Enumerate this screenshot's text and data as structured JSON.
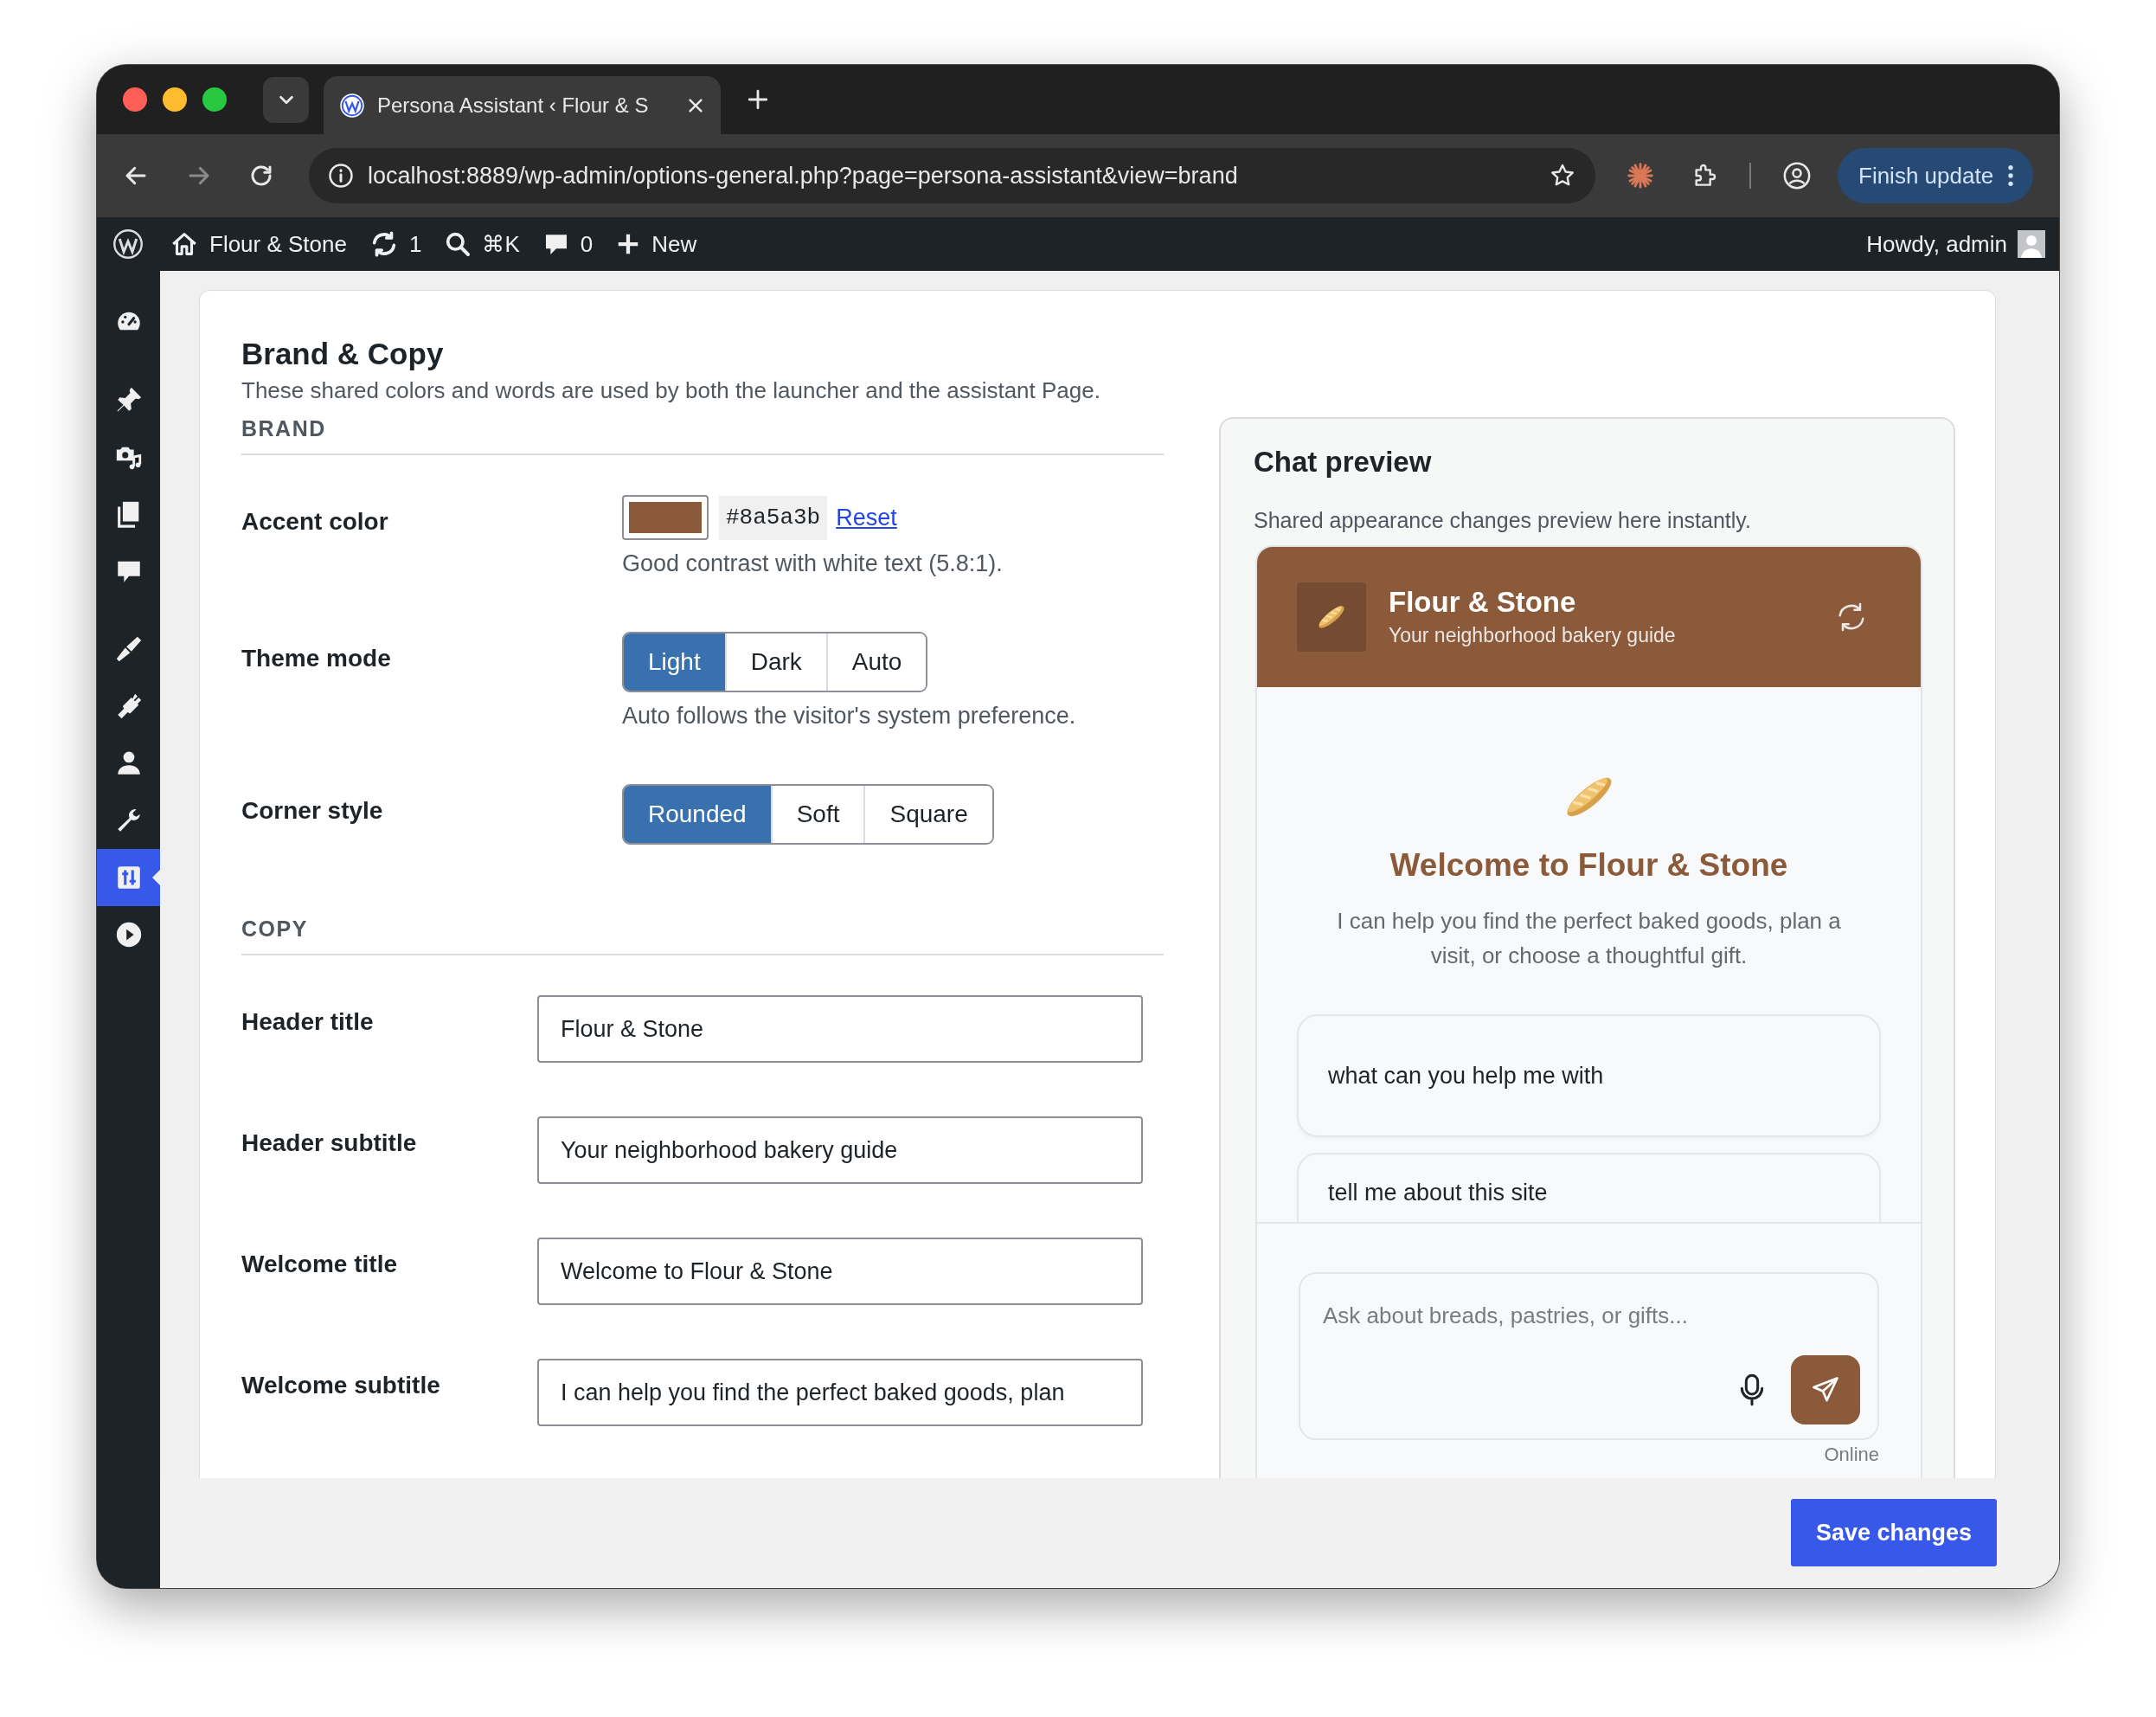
{
  "browser": {
    "tab_title": "Persona Assistant ‹ Flour & S",
    "url": "localhost:8889/wp-admin/options-general.php?page=persona-assistant&view=brand",
    "update_button": "Finish update"
  },
  "admin_bar": {
    "site_name": "Flour & Stone",
    "updates": "1",
    "search_shortcut": "⌘K",
    "comments": "0",
    "new_label": "New",
    "greeting": "Howdy, admin"
  },
  "sidebar": {
    "items": [
      {
        "selected": false
      },
      {
        "selected": false
      },
      {
        "selected": false
      },
      {
        "selected": false
      },
      {
        "selected": false
      },
      {
        "selected": false
      },
      {
        "selected": false
      },
      {
        "selected": false
      },
      {
        "selected": false
      },
      {
        "selected": true
      },
      {
        "selected": false
      }
    ]
  },
  "settings": {
    "title": "Brand & Copy",
    "description": "These shared colors and words are used by both the launcher and the assistant Page.",
    "sections": [
      {
        "heading": "BRAND",
        "fields": [
          {
            "kind": "color",
            "label": "Accent color",
            "color": "#8a5a3b",
            "value": "#8a5a3b",
            "reset_link": "Reset",
            "help": "Good contrast with white text (5.8:1)."
          },
          {
            "kind": "segmented",
            "label": "Theme mode",
            "options": [
              {
                "label": "Light",
                "selected": true
              },
              {
                "label": "Dark",
                "selected": false
              },
              {
                "label": "Auto",
                "selected": false
              }
            ],
            "help": "Auto follows the visitor's system preference."
          },
          {
            "kind": "segmented",
            "label": "Corner style",
            "options": [
              {
                "label": "Rounded",
                "selected": true
              },
              {
                "label": "Soft",
                "selected": false
              },
              {
                "label": "Square",
                "selected": false
              }
            ]
          }
        ]
      },
      {
        "heading": "COPY",
        "fields": [
          {
            "kind": "text",
            "label": "Header title",
            "value": "Flour & Stone"
          },
          {
            "kind": "text",
            "label": "Header subtitle",
            "value": "Your neighborhood bakery guide"
          },
          {
            "kind": "text",
            "label": "Welcome title",
            "value": "Welcome to Flour & Stone"
          },
          {
            "kind": "text",
            "label": "Welcome subtitle",
            "value": "I can help you find the perfect baked goods, plan"
          }
        ]
      }
    ]
  },
  "preview": {
    "title": "Chat preview",
    "description": "Shared appearance changes preview here instantly.",
    "chat": {
      "header_title": "Flour & Stone",
      "header_subtitle": "Your neighborhood bakery guide",
      "welcome_title": "Welcome to Flour & Stone",
      "welcome_subtitle": "I can help you find the perfect baked goods, plan a visit, or choose a thoughtful gift.",
      "suggestions": [
        "what can you help me with",
        "tell me about this site"
      ],
      "input_placeholder": "Ask about breads, pastries, or gifts...",
      "status": "Online"
    }
  },
  "save_button": "Save changes"
}
